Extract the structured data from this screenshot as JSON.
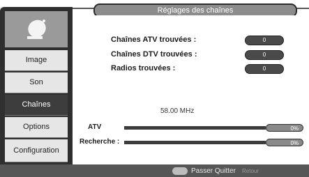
{
  "header": {
    "title": "Réglages des chaînes"
  },
  "sidebar": {
    "logo_icon": "satellite-dish-icon",
    "items": [
      {
        "label": "Image",
        "active": false
      },
      {
        "label": "Son",
        "active": false
      },
      {
        "label": "Chaînes",
        "active": true
      },
      {
        "label": "Options",
        "active": false
      },
      {
        "label": "Configuration",
        "active": false
      }
    ]
  },
  "scan": {
    "rows": [
      {
        "label": "Chaînes ATV trouvées :",
        "count": "0"
      },
      {
        "label": "Chaînes DTV trouvées :",
        "count": "0"
      },
      {
        "label": "Radios trouvées :",
        "count": "0"
      }
    ],
    "frequency": "58.00 MHz",
    "progress": [
      {
        "label": "ATV",
        "percent_text": "0%",
        "fraction": 0
      },
      {
        "label": "Recherche :",
        "percent_text": "0%",
        "fraction": 0
      }
    ]
  },
  "footer": {
    "action_text": "Passer Quitter",
    "ghost_text": "Retour"
  },
  "colors": {
    "active_menu": "#3d3d3d",
    "menu_bg": "#e6e6e6",
    "title_pill": "#8c8c8c",
    "count_pill": "#4a4a4a",
    "footer": "#565656"
  }
}
